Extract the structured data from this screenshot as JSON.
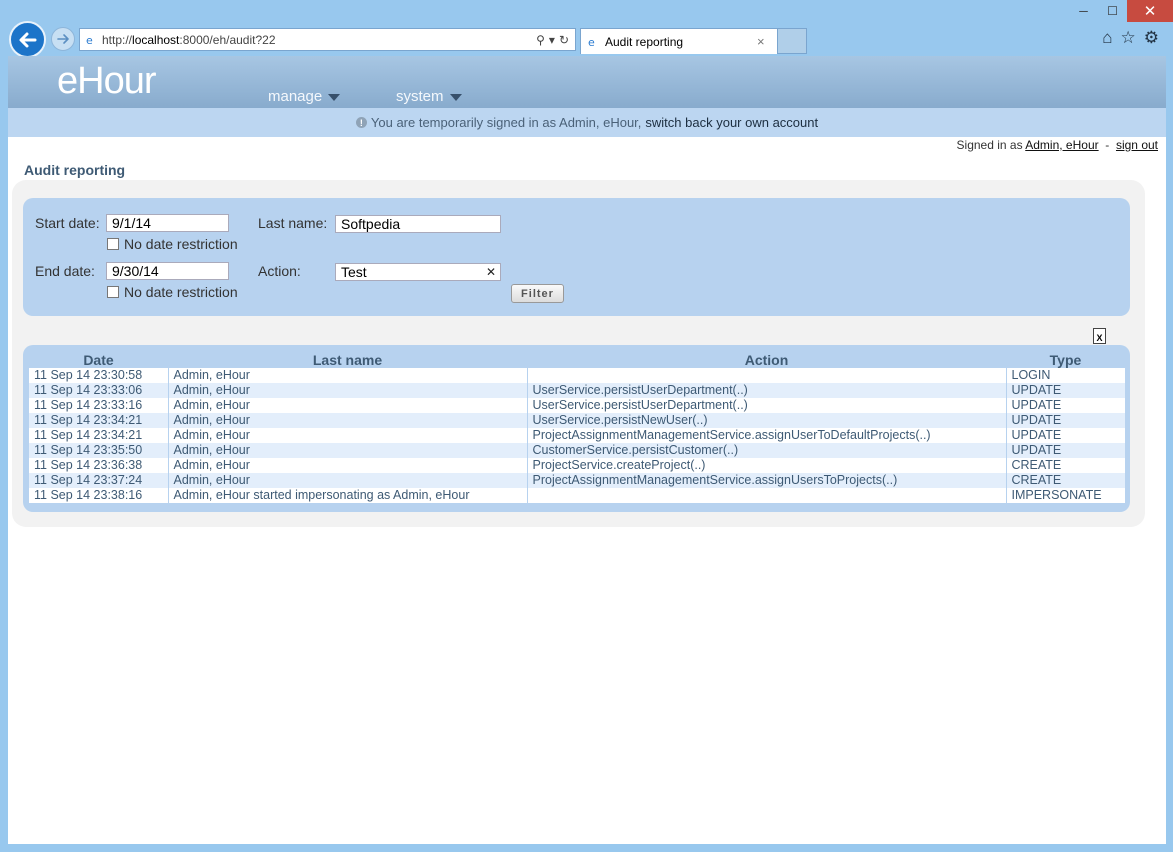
{
  "browser": {
    "url_prefix": "http://",
    "url_host": "localhost",
    "url_rest": ":8000/eh/audit?22",
    "tab_title": "Audit reporting",
    "tab_close": "×",
    "search_icon": "⚲",
    "dropdown_icon": "▾",
    "refresh_icon": "↻",
    "home_icon": "⌂",
    "star_icon": "☆",
    "gear_icon": "⚙",
    "minimize_icon": "─",
    "maximize_icon": "☐",
    "close_icon": "✕"
  },
  "app": {
    "logo": "eHour",
    "menu": [
      {
        "label": "manage"
      },
      {
        "label": "system"
      }
    ],
    "impersonate_text": "You are temporarily signed in as Admin, eHour,",
    "impersonate_link": "switch back your own account",
    "signed_in_prefix": "Signed in as",
    "signed_in_user": "Admin, eHour",
    "signed_in_sep": "-",
    "sign_out": "sign out",
    "page_title": "Audit reporting"
  },
  "filter": {
    "start_date_label": "Start date:",
    "start_date_value": "9/1/14",
    "end_date_label": "End date:",
    "end_date_value": "9/30/14",
    "no_restriction_label": "No date restriction",
    "last_name_label": "Last name:",
    "last_name_value": "Softpedia",
    "action_label": "Action:",
    "action_value": "Test",
    "clear_icon": "✕",
    "filter_button": "Filter",
    "excel_icon_label": "X"
  },
  "table": {
    "headers": {
      "date": "Date",
      "last_name": "Last name",
      "action": "Action",
      "type": "Type"
    },
    "rows": [
      {
        "date": "11 Sep 14 23:30:58",
        "last_name": "Admin, eHour",
        "action": "",
        "type": "LOGIN"
      },
      {
        "date": "11 Sep 14 23:33:06",
        "last_name": "Admin, eHour",
        "action": "UserService.persistUserDepartment(..)",
        "type": "UPDATE"
      },
      {
        "date": "11 Sep 14 23:33:16",
        "last_name": "Admin, eHour",
        "action": "UserService.persistUserDepartment(..)",
        "type": "UPDATE"
      },
      {
        "date": "11 Sep 14 23:34:21",
        "last_name": "Admin, eHour",
        "action": "UserService.persistNewUser(..)",
        "type": "UPDATE"
      },
      {
        "date": "11 Sep 14 23:34:21",
        "last_name": "Admin, eHour",
        "action": "ProjectAssignmentManagementService.assignUserToDefaultProjects(..)",
        "type": "UPDATE"
      },
      {
        "date": "11 Sep 14 23:35:50",
        "last_name": "Admin, eHour",
        "action": "CustomerService.persistCustomer(..)",
        "type": "UPDATE"
      },
      {
        "date": "11 Sep 14 23:36:38",
        "last_name": "Admin, eHour",
        "action": "ProjectService.createProject(..)",
        "type": "CREATE"
      },
      {
        "date": "11 Sep 14 23:37:24",
        "last_name": "Admin, eHour",
        "action": "ProjectAssignmentManagementService.assignUsersToProjects(..)",
        "type": "CREATE"
      },
      {
        "date": "11 Sep 14 23:38:16",
        "last_name": "Admin, eHour started impersonating as Admin, eHour",
        "action": "",
        "type": "IMPERSONATE"
      }
    ]
  }
}
